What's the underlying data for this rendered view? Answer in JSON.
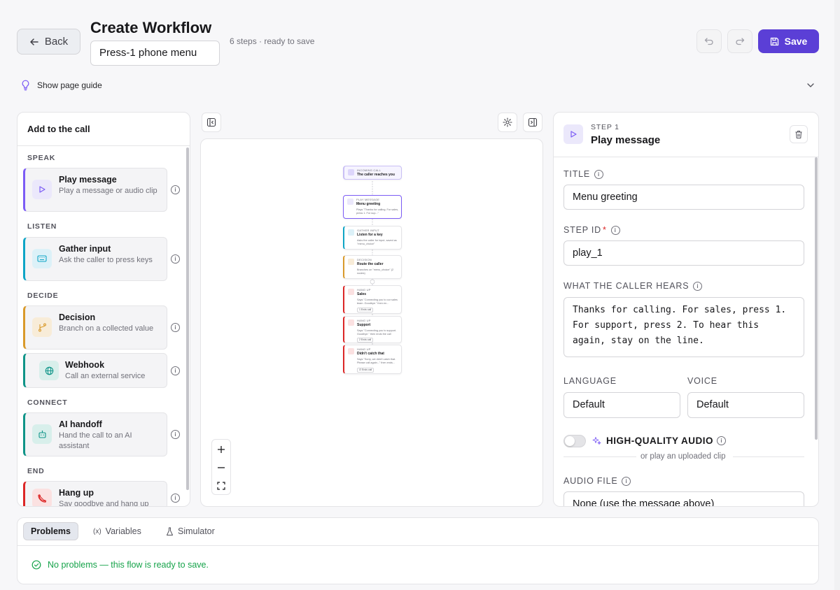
{
  "header": {
    "back_label": "Back",
    "title": "Create Workflow",
    "workflow_name": "Press-1 phone menu",
    "meta": "6 steps · ready to save",
    "save_label": "Save"
  },
  "guide": {
    "label": "Show page guide"
  },
  "palette": {
    "title": "Add to the call",
    "sections": {
      "speak": "SPEAK",
      "listen": "LISTEN",
      "decide": "DECIDE",
      "connect": "CONNECT",
      "end": "END"
    },
    "items": [
      {
        "title": "Play message",
        "desc": "Play a message or audio clip",
        "icon": "play-icon",
        "color": "#7c5cf5"
      },
      {
        "title": "Gather input",
        "desc": "Ask the caller to press keys",
        "icon": "keyboard-icon",
        "color": "#0ea5c6"
      },
      {
        "title": "Decision",
        "desc": "Branch on a collected value",
        "icon": "branch-icon",
        "color": "#d99a2b"
      },
      {
        "title": "Webhook",
        "desc": "Call an external service",
        "icon": "globe-icon",
        "color": "#0f9488"
      },
      {
        "title": "AI handoff",
        "desc": "Hand the call to an AI assistant",
        "icon": "bot-icon",
        "color": "#0f9488"
      },
      {
        "title": "Hang up",
        "desc": "Say goodbye and hang up",
        "icon": "phone-off-icon",
        "color": "#dc2626"
      }
    ]
  },
  "canvas_nodes": [
    {
      "kind": "INCOMING CALL",
      "title": "The caller reaches you",
      "desc": ""
    },
    {
      "kind": "PLAY MESSAGE",
      "title": "Menu greeting",
      "desc": "Plays \"Thanks for calling. For sales, press 1. For sup...\""
    },
    {
      "kind": "GATHER INPUT",
      "title": "Listen for a key",
      "desc": "Asks the caller for input, saved as \"menu_choice\""
    },
    {
      "kind": "DECISION",
      "title": "Route the caller",
      "desc": "Branches on \"menu_choice\" (2 routes)"
    },
    {
      "kind": "HANG UP",
      "title": "Sales",
      "desc": "Says \"Connecting you to our sales team. Goodbye.\" then en...",
      "chip": "1 Ends call"
    },
    {
      "kind": "HANG UP",
      "title": "Support",
      "desc": "Says \"Connecting you to support. Goodbye.\" then ends the call",
      "chip": "2 Ends call"
    },
    {
      "kind": "HANG UP",
      "title": "Didn't catch that",
      "desc": "Says \"Sorry, we didn't catch that. Please call again...\" then ends...",
      "chip": "∅ Ends call"
    }
  ],
  "inspector": {
    "step_label": "STEP 1",
    "step_title": "Play message",
    "title_label": "TITLE",
    "title_value": "Menu greeting",
    "stepid_label": "STEP ID",
    "stepid_required": "*",
    "stepid_value": "play_1",
    "hears_label": "WHAT THE CALLER HEARS",
    "hears_value": "Thanks for calling. For sales, press 1.\nFor support, press 2. To hear this\nagain, stay on the line.",
    "language_label": "LANGUAGE",
    "language_value": "Default",
    "voice_label": "VOICE",
    "voice_value": "Default",
    "hq_label": "HIGH-QUALITY AUDIO",
    "or_text": "or play an uploaded clip",
    "audio_label": "AUDIO FILE",
    "audio_value": "None (use the message above)"
  },
  "bottom": {
    "tabs": [
      "Problems",
      "Variables",
      "Simulator"
    ],
    "status": "No problems — this flow is ready to save."
  },
  "colors": {
    "accent": "#5b3fd6",
    "success": "#16a34a"
  }
}
